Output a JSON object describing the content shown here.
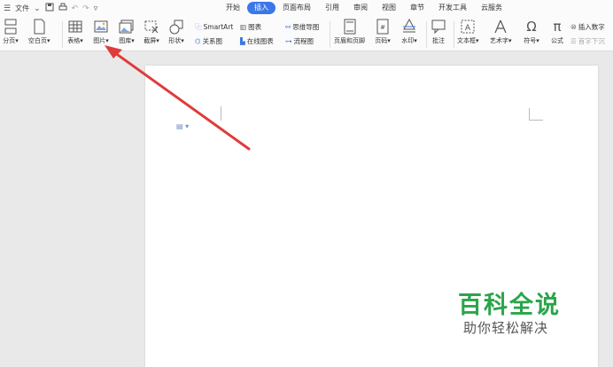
{
  "titlebar": {
    "menu_label": "文件"
  },
  "tabs": [
    "开始",
    "插入",
    "页面布局",
    "引用",
    "审阅",
    "视图",
    "章节",
    "开发工具",
    "云服务"
  ],
  "active_tab": "插入",
  "ribbon": {
    "page_break": "分页",
    "blank_page": "空白页",
    "table": "表格",
    "picture": "图片",
    "gallery": "图库",
    "screenshot": "截屏",
    "shape": "形状",
    "smartart": "SmartArt",
    "chart": "图表",
    "mindmap": "思维导图",
    "relation": "关系图",
    "online_chart": "在线图表",
    "flowchart": "流程图",
    "header_footer": "页眉和页脚",
    "page_number": "页码",
    "watermark": "水印",
    "comment": "批注",
    "textbox": "文本框",
    "wordart": "艺术字",
    "symbol": "符号",
    "formula": "公式",
    "insert_number": "插入数字",
    "first_letter": "首字下沉"
  },
  "watermark": {
    "title": "百科全说",
    "subtitle": "助你轻松解决"
  },
  "colors": {
    "accent": "#3b78e7",
    "arrow": "#e03b3b",
    "watermark_green": "#2aa54a"
  }
}
